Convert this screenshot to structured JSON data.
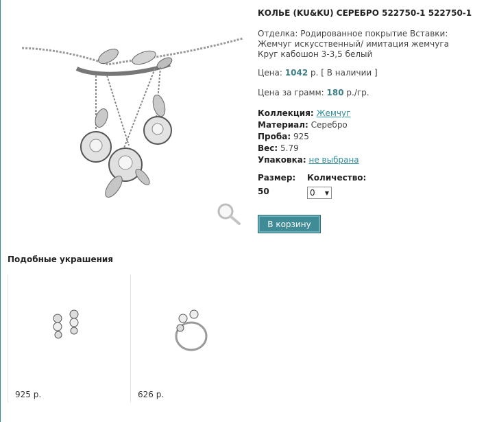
{
  "product": {
    "title": "КОЛЬЕ (KU&KU) СЕРЕБРО 522750-1 522750-1",
    "finish_text": "Отделка: Родированное покрытие Вставки: Жемчуг искусственный/ имитация жемчуга Круг кабошон 3-3,5 белый",
    "price_label": "Цена:",
    "price_value": "1042",
    "price_suffix": "р. [ В наличии ]",
    "gram_label": "Цена за грамм:",
    "gram_value": "180",
    "gram_suffix": "р./гр.",
    "collection_label": "Коллекция:",
    "collection_value": "Жемчуг",
    "material_label": "Материал:",
    "material_value": "Серебро",
    "proba_label": "Проба:",
    "proba_value": "925",
    "weight_label": "Вес:",
    "weight_value": "5.79",
    "package_label": "Упаковка:",
    "package_value": "не выбрана",
    "size_label": "Размер:",
    "size_value": "50",
    "qty_label": "Количество:",
    "qty_value": "0",
    "cart_button": "В корзину"
  },
  "similar": {
    "heading": "Подобные украшения",
    "items": [
      {
        "price": "925 р.",
        "icon": "earrings-image"
      },
      {
        "price": "626 р.",
        "icon": "ring-image"
      }
    ]
  },
  "colors": {
    "accent": "#3f8b96",
    "price": "#3e7f86",
    "link": "#2f8d99"
  }
}
